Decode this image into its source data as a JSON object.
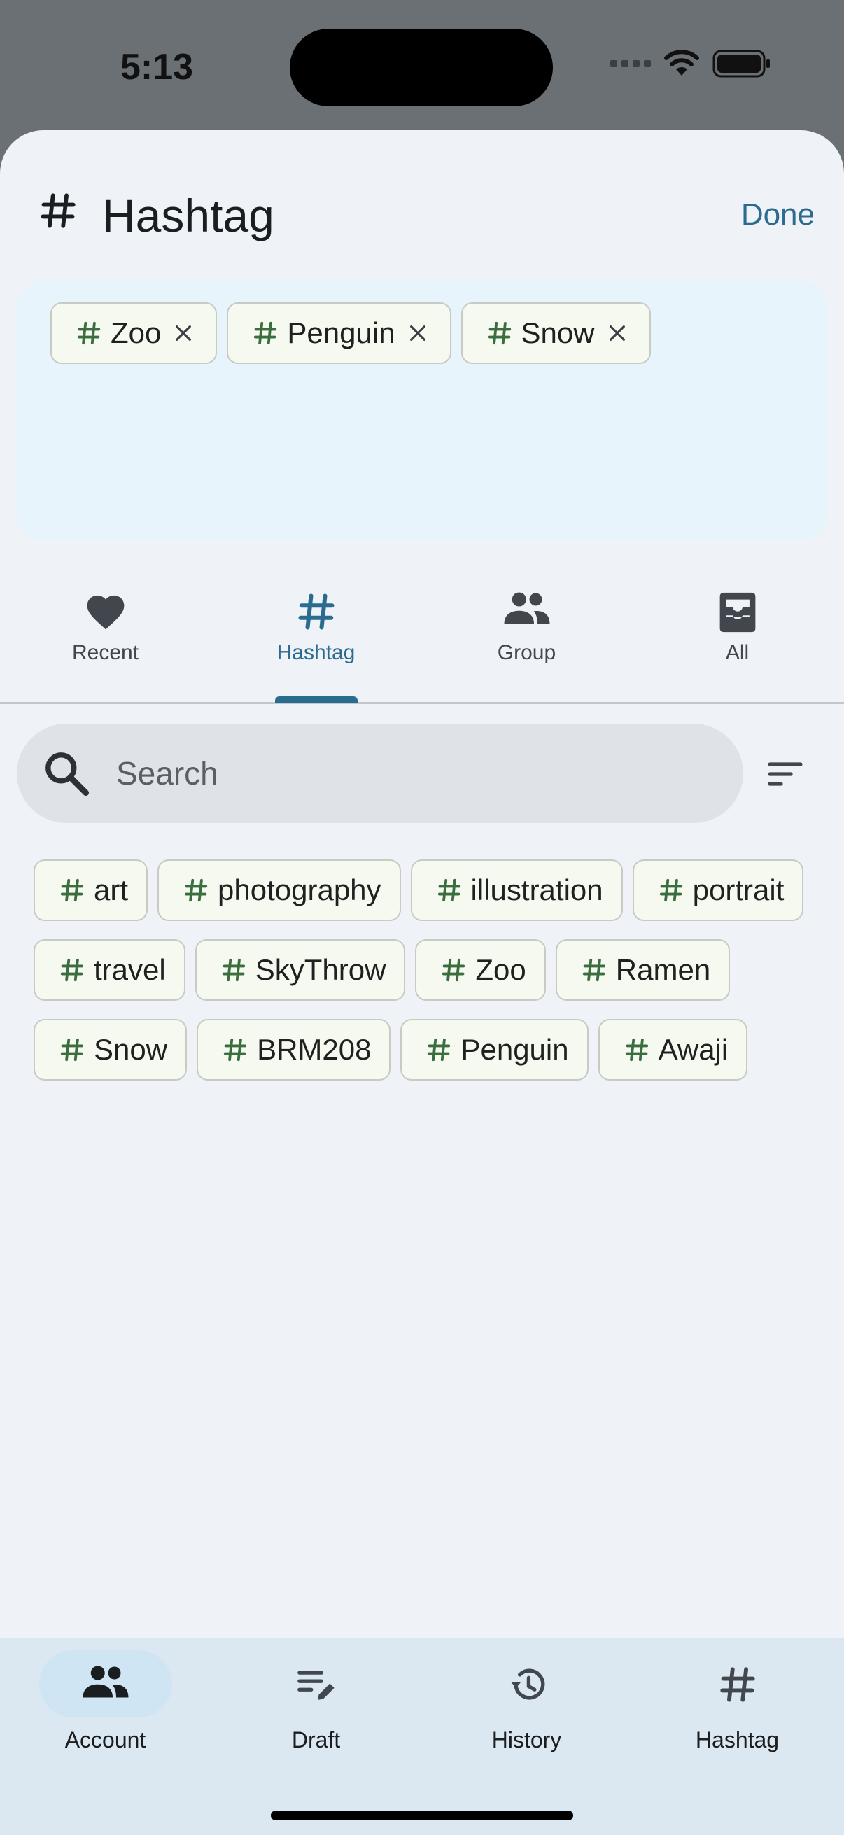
{
  "status_bar": {
    "time": "5:13"
  },
  "header": {
    "title": "Hashtag",
    "done_label": "Done",
    "icon": "hashtag-icon"
  },
  "selected_tags": [
    {
      "label": "Zoo"
    },
    {
      "label": "Penguin"
    },
    {
      "label": "Snow"
    }
  ],
  "tabs": [
    {
      "label": "Recent",
      "icon": "heart-icon"
    },
    {
      "label": "Hashtag",
      "icon": "hashtag-icon",
      "active": true
    },
    {
      "label": "Group",
      "icon": "group-icon"
    },
    {
      "label": "All",
      "icon": "inbox-icon"
    }
  ],
  "search": {
    "placeholder": "Search",
    "value": ""
  },
  "tags": [
    {
      "label": "art"
    },
    {
      "label": "photography"
    },
    {
      "label": "illustration"
    },
    {
      "label": "portrait"
    },
    {
      "label": "travel"
    },
    {
      "label": "SkyThrow"
    },
    {
      "label": "Zoo"
    },
    {
      "label": "Ramen"
    },
    {
      "label": "Snow"
    },
    {
      "label": "BRM208"
    },
    {
      "label": "Penguin"
    },
    {
      "label": "Awaji"
    }
  ],
  "bottom_nav": [
    {
      "label": "Account",
      "icon": "account-icon",
      "active": true
    },
    {
      "label": "Draft",
      "icon": "draft-icon"
    },
    {
      "label": "History",
      "icon": "history-icon"
    },
    {
      "label": "Hashtag",
      "icon": "hashtag-icon"
    }
  ],
  "colors": {
    "accent": "#2a6b8f",
    "hash_green": "#3b6e3f",
    "chip_bg": "#f5f9ef",
    "sheet_bg": "#eff3f8",
    "selected_area_bg": "#e7f4fc",
    "nav_bg": "#dce8f1"
  }
}
